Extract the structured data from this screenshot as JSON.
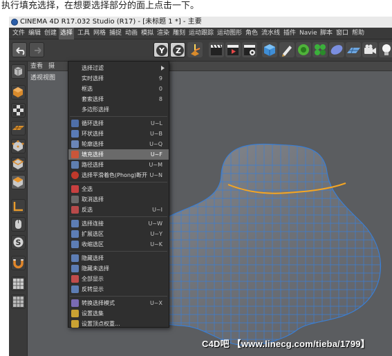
{
  "caption": "执行填充选择，在想要选择部分的面上点击一下。",
  "window": {
    "title": "CINEMA 4D R17.032 Studio (R17) - [未标题 1 *] - 主要"
  },
  "menubar": [
    {
      "label": "文件"
    },
    {
      "label": "编辑"
    },
    {
      "label": "创建"
    },
    {
      "label": "选择"
    },
    {
      "label": "工具"
    },
    {
      "label": "网格"
    },
    {
      "label": "捕捉"
    },
    {
      "label": "动画"
    },
    {
      "label": "模拟"
    },
    {
      "label": "渲染"
    },
    {
      "label": "雕刻"
    },
    {
      "label": "运动跟踪"
    },
    {
      "label": "运动图形"
    },
    {
      "label": "角色"
    },
    {
      "label": "流水线"
    },
    {
      "label": "插件"
    },
    {
      "label": "Navie"
    },
    {
      "label": "脚本"
    },
    {
      "label": "窗口"
    },
    {
      "label": "帮助"
    }
  ],
  "viewport": {
    "menu": [
      "查看",
      "摄"
    ],
    "label": "透视视图"
  },
  "select_menu": {
    "items": [
      {
        "label": "选择过滤",
        "shortcut": "",
        "icon": "none"
      },
      {
        "label": "实时选择",
        "shortcut": "9",
        "icon": "none"
      },
      {
        "label": "框选",
        "shortcut": "0",
        "icon": "none"
      },
      {
        "label": "套索选择",
        "shortcut": "8",
        "icon": "none"
      },
      {
        "label": "多边形选择",
        "shortcut": "",
        "icon": "none"
      },
      {
        "label": "循环选择",
        "shortcut": "U~L",
        "icon": "loop-select-icon"
      },
      {
        "label": "环状选择",
        "shortcut": "U~B",
        "icon": "ring-select-icon"
      },
      {
        "label": "轮廓选择",
        "shortcut": "U~Q",
        "icon": "outline-select-icon"
      },
      {
        "label": "填充选择",
        "shortcut": "U~F",
        "icon": "fill-select-icon"
      },
      {
        "label": "路径选择",
        "shortcut": "U~M",
        "icon": "path-select-icon"
      },
      {
        "label": "选择平滑着色(Phong)断开",
        "shortcut": "U~N",
        "icon": "phong-break-select-icon"
      },
      {
        "label": "全选",
        "shortcut": "",
        "icon": "select-all-icon"
      },
      {
        "label": "取消选择",
        "shortcut": "",
        "icon": "deselect-icon"
      },
      {
        "label": "反选",
        "shortcut": "U~I",
        "icon": "invert-select-icon"
      },
      {
        "label": "选择连接",
        "shortcut": "U~W",
        "icon": "select-connected-icon"
      },
      {
        "label": "扩展选区",
        "shortcut": "U~Y",
        "icon": "grow-selection-icon"
      },
      {
        "label": "收缩选区",
        "shortcut": "U~K",
        "icon": "shrink-selection-icon"
      },
      {
        "label": "隐藏选择",
        "shortcut": "",
        "icon": "hide-selected-icon"
      },
      {
        "label": "隐藏未选择",
        "shortcut": "",
        "icon": "hide-unselected-icon"
      },
      {
        "label": "全部显示",
        "shortcut": "",
        "icon": "unhide-all-icon"
      },
      {
        "label": "反转显示",
        "shortcut": "",
        "icon": "invert-visibility-icon"
      },
      {
        "label": "转换选择模式",
        "shortcut": "U~X",
        "icon": "convert-selection-icon"
      },
      {
        "label": "设置选集",
        "shortcut": "",
        "icon": "set-selection-icon"
      },
      {
        "label": "设置顶点权重...",
        "shortcut": "",
        "icon": "set-vertex-weight-icon"
      }
    ]
  },
  "watermark": "C4D吧 【www.linecg.com/tieba/1799】",
  "colors": {
    "highlight": "#6a6a6a",
    "mesh_fill": "#7e8188",
    "wire": "#3b7fd4",
    "selected_edge": "#f5a623"
  }
}
